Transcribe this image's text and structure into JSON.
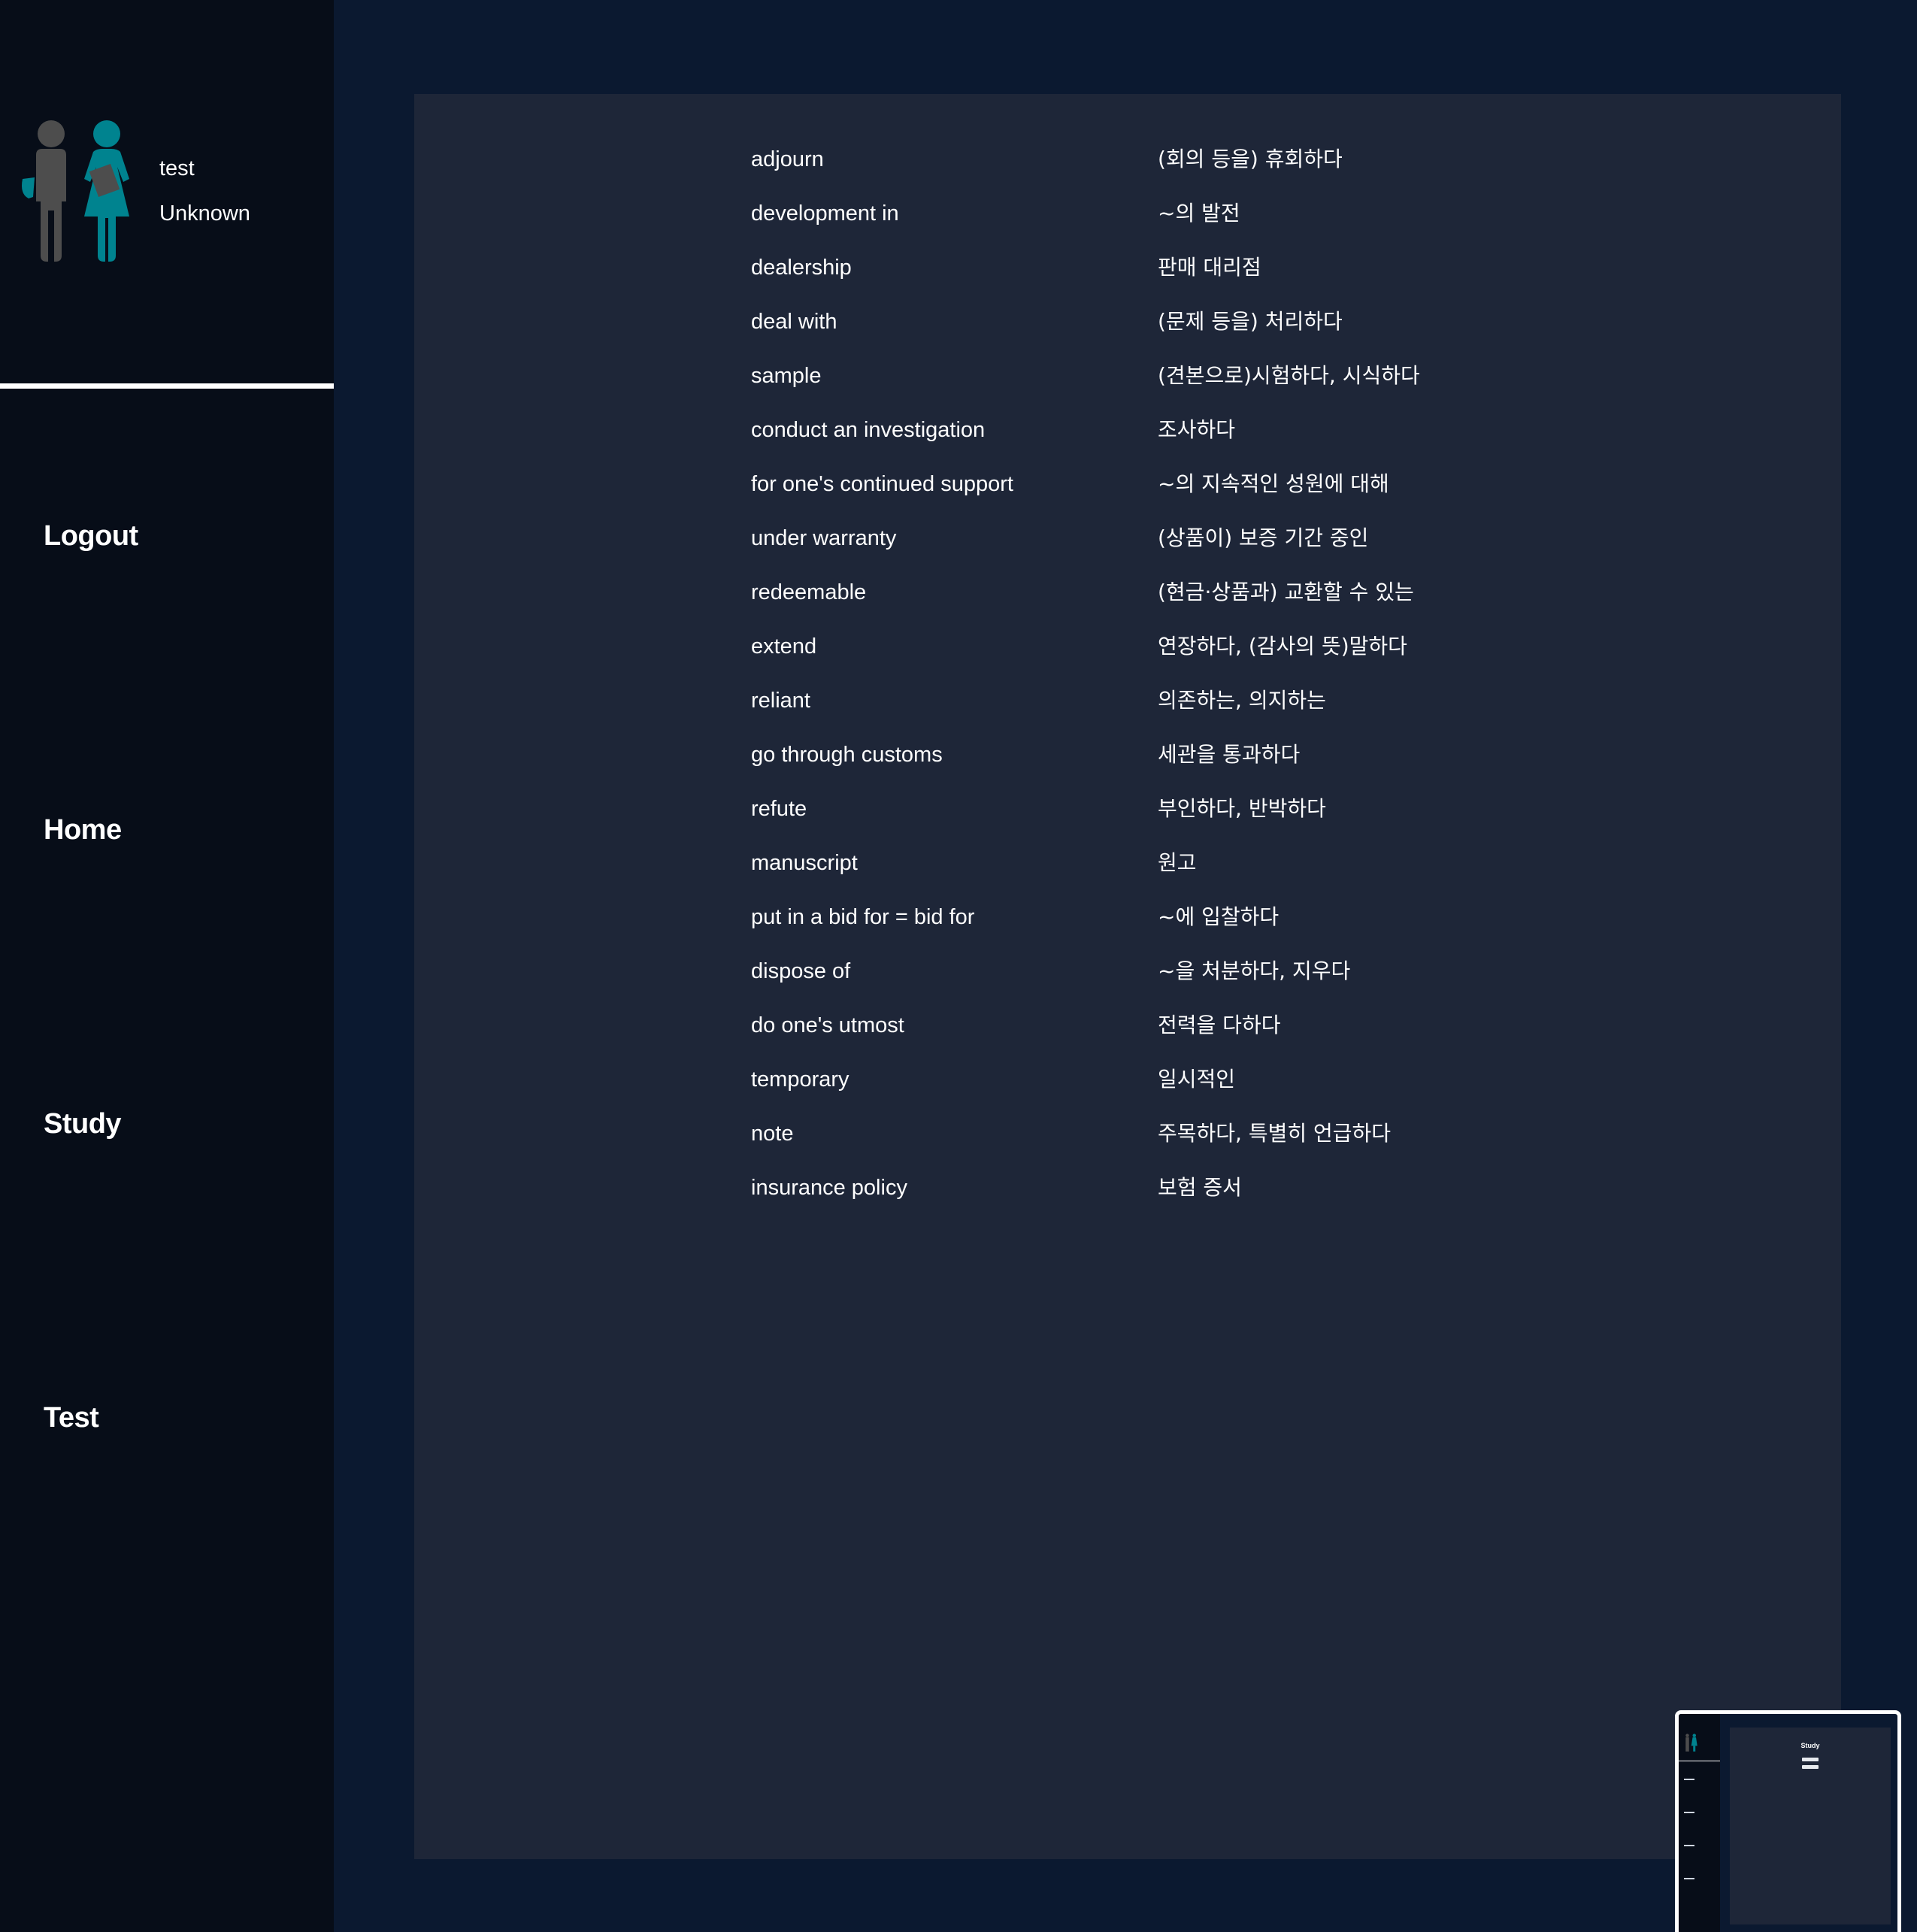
{
  "profile": {
    "name": "test",
    "status": "Unknown"
  },
  "nav": {
    "logout": "Logout",
    "home": "Home",
    "study": "Study",
    "test": "Test"
  },
  "vocabulary": [
    {
      "word": "adjourn",
      "meaning": "(회의 등을) 휴회하다"
    },
    {
      "word": "development in",
      "meaning": "~의 발전"
    },
    {
      "word": "dealership",
      "meaning": "판매 대리점"
    },
    {
      "word": "deal with",
      "meaning": "(문제 등을) 처리하다"
    },
    {
      "word": "sample",
      "meaning": "(견본으로)시험하다, 시식하다"
    },
    {
      "word": "conduct an investigation",
      "meaning": "조사하다"
    },
    {
      "word": "for one's continued support",
      "meaning": "~의 지속적인 성원에 대해"
    },
    {
      "word": "under warranty",
      "meaning": "(상품이) 보증 기간 중인"
    },
    {
      "word": "redeemable",
      "meaning": "(현금·상품과) 교환할 수 있는"
    },
    {
      "word": "extend",
      "meaning": "연장하다, (감사의 뜻)말하다"
    },
    {
      "word": "reliant",
      "meaning": "의존하는, 의지하는"
    },
    {
      "word": "go through customs",
      "meaning": "세관을 통과하다"
    },
    {
      "word": "refute",
      "meaning": "부인하다, 반박하다"
    },
    {
      "word": "manuscript",
      "meaning": "원고"
    },
    {
      "word": "put in a bid for = bid for",
      "meaning": "~에 입찰하다"
    },
    {
      "word": "dispose of",
      "meaning": "~을 처분하다, 지우다"
    },
    {
      "word": "do one's utmost",
      "meaning": "전력을 다하다"
    },
    {
      "word": "temporary",
      "meaning": "일시적인"
    },
    {
      "word": "note",
      "meaning": "주목하다, 특별히 언급하다"
    },
    {
      "word": "insurance policy",
      "meaning": "보험 증서"
    }
  ],
  "thumbnail": {
    "title": "Study"
  },
  "colors": {
    "page_background": "#0b1930",
    "sidebar_background": "#070d18",
    "panel_background": "#1e2638",
    "avatar_male": "#4d4d4d",
    "avatar_female": "#00838f"
  },
  "icons": {
    "avatar": "couple-avatar-icon"
  }
}
